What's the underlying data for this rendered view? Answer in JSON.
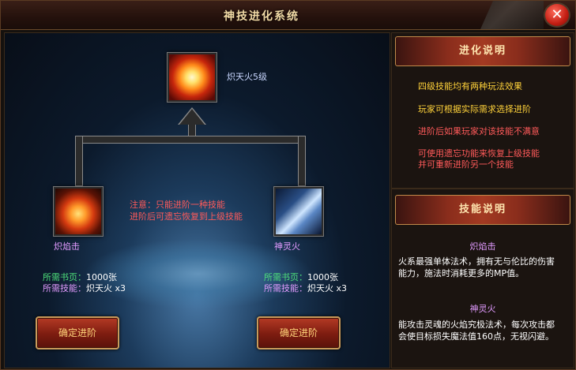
{
  "window": {
    "title": "神技进化系统",
    "close_glyph": "✕"
  },
  "tree": {
    "top_skill": {
      "name": "炽天火5级",
      "icon": "sun-fire-icon"
    },
    "left_skill": {
      "name": "炽焰击",
      "icon": "flame-burst-icon"
    },
    "right_skill": {
      "name": "神灵火",
      "icon": "spirit-fire-icon"
    },
    "notice": [
      "注意：只能进阶一种技能",
      "进阶后可遗忘恢复到上级技能"
    ]
  },
  "left_req": {
    "book_label": "所需书页：",
    "book_value": "1000张",
    "skill_label": "所需技能：",
    "skill_value": "炽天火 x3",
    "button": "确定进阶"
  },
  "right_req": {
    "book_label": "所需书页：",
    "book_value": "1000张",
    "skill_label": "所需技能：",
    "skill_value": "炽天火 x3",
    "button": "确定进阶"
  },
  "sidebar": {
    "evolution_header": "进化说明",
    "tips": [
      "四级技能均有两种玩法效果",
      "玩家可根据实际需求选择进阶",
      "进阶后如果玩家对该技能不满意",
      "可使用遗忘功能来恢复上级技能",
      "并可重新进阶另一个技能"
    ],
    "skill_header": "技能说明",
    "skill1": {
      "name": "炽焰击",
      "desc": [
        "火系最强单体法术，拥有无与伦比的伤害",
        "能力，施法时消耗更多的MP值。"
      ]
    },
    "skill2": {
      "name": "神灵火",
      "desc": [
        "能攻击灵魂的火焰究极法术，每次攻击都",
        "会使目标损失魔法值160点，无视闪避。"
      ]
    }
  },
  "colors": {
    "accent": "#ffd47a",
    "notice": "#ff5a5a",
    "tip": "#ffd23a",
    "skill_name": "#e29bff",
    "req_label": "#4ee07a"
  }
}
